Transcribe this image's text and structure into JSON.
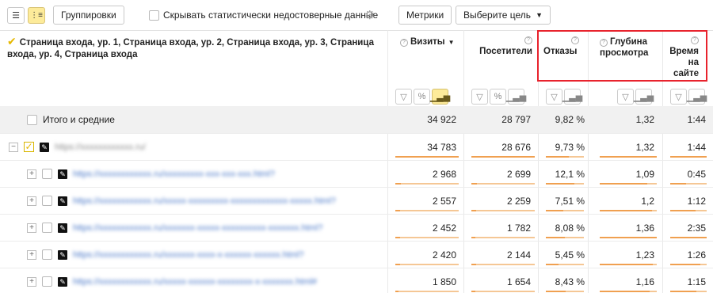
{
  "toolbar": {
    "groupings_label": "Группировки",
    "hide_stat_label": "Скрывать статистически недостоверные данные",
    "metrics_label": "Метрики",
    "goal_label": "Выберите цель"
  },
  "header": {
    "segment_title": "Страница входа, ур. 1, Страница входа, ур. 2, Страница входа, ур. 3, Страница входа, ур. 4, Страница входа",
    "columns": {
      "visits": "Визиты",
      "visitors": "Посетители",
      "bounces": "Отказы",
      "depth": "Глубина просмотра",
      "time": "Время на сайте"
    }
  },
  "totals": {
    "label": "Итого и средние",
    "visits": "34 922",
    "visitors": "28 797",
    "bounces": "9,82 %",
    "depth": "1,32",
    "time": "1:44"
  },
  "rows": [
    {
      "url": "https://xxxxxxxxxxxx.ru/",
      "visits": "34 783",
      "visitors": "28 676",
      "bounces": "9,73 %",
      "depth": "1,32",
      "time": "1:44",
      "share": {
        "visits": 1.0,
        "visitors": 1.0,
        "bounces": 0.6,
        "depth": 1.0,
        "time": 1.0
      }
    },
    {
      "url": "https://xxxxxxxxxxxx.ru/xxxxxxxxx-xxx-xxx-xxx.html?",
      "visits": "2 968",
      "visitors": "2 699",
      "bounces": "12,1 %",
      "depth": "1,09",
      "time": "0:45",
      "share": {
        "visits": 0.09,
        "visitors": 0.09,
        "bounces": 0.75,
        "depth": 0.83,
        "time": 0.43
      }
    },
    {
      "url": "https://xxxxxxxxxxxx.ru/xxxxx-xxxxxxxxx-xxxxxxxxxxxxx-xxxxx.html?",
      "visits": "2 557",
      "visitors": "2 259",
      "bounces": "7,51 %",
      "depth": "1,2",
      "time": "1:12",
      "share": {
        "visits": 0.07,
        "visitors": 0.08,
        "bounces": 0.46,
        "depth": 0.91,
        "time": 0.69
      }
    },
    {
      "url": "https://xxxxxxxxxxxx.ru/xxxxxxx-xxxxx-xxxxxxxxxx-xxxxxxx.html?",
      "visits": "2 452",
      "visitors": "1 782",
      "bounces": "8,08 %",
      "depth": "1,36",
      "time": "2:35",
      "share": {
        "visits": 0.07,
        "visitors": 0.06,
        "bounces": 0.5,
        "depth": 1.0,
        "time": 1.0
      }
    },
    {
      "url": "https://xxxxxxxxxxxx.ru/xxxxxxx-xxxx-x-xxxxxx-xxxxxx.html?",
      "visits": "2 420",
      "visitors": "2 144",
      "bounces": "5,45 %",
      "depth": "1,23",
      "time": "1:26",
      "share": {
        "visits": 0.07,
        "visitors": 0.07,
        "bounces": 0.34,
        "depth": 0.93,
        "time": 0.83
      }
    },
    {
      "url": "https://xxxxxxxxxxxx.ru/xxxxx-xxxxxx-xxxxxxxx-x-xxxxxxx.html#",
      "visits": "1 850",
      "visitors": "1 654",
      "bounces": "8,43 %",
      "depth": "1,16",
      "time": "1:15",
      "share": {
        "visits": 0.05,
        "visitors": 0.06,
        "bounces": 0.52,
        "depth": 0.88,
        "time": 0.72
      }
    }
  ]
}
